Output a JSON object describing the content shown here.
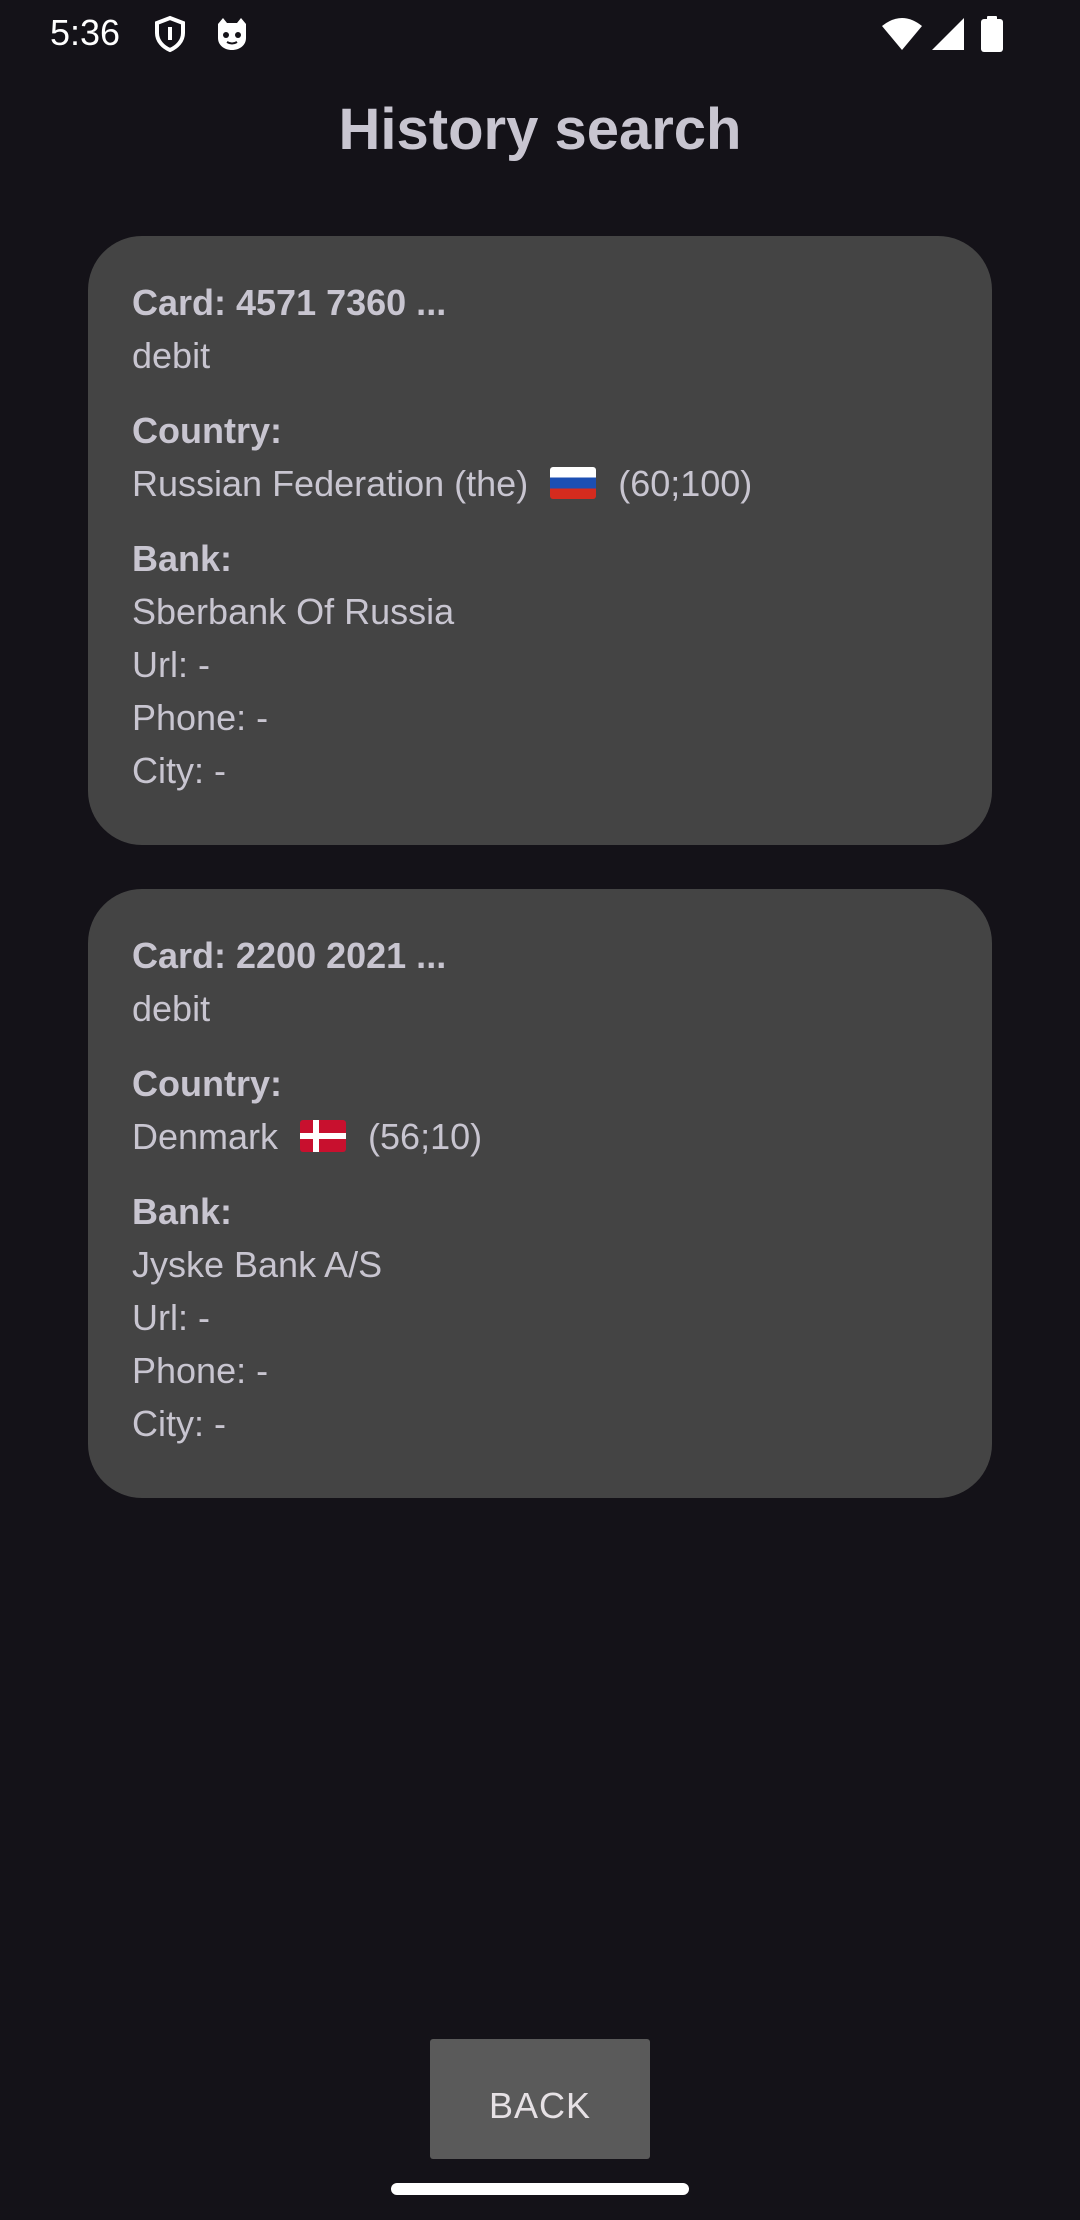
{
  "status_bar": {
    "time": "5:36",
    "left_icons": [
      "shield-icon",
      "cat-face-icon"
    ],
    "right_icons": [
      "wifi-icon",
      "signal-icon",
      "battery-icon"
    ]
  },
  "page": {
    "title": "History search"
  },
  "cards": [
    {
      "card_label": "Card: 4571 7360 ...",
      "card_type": "debit",
      "country_label": "Country:",
      "country_name": "Russian Federation (the)",
      "country_flag": "flag-russia-icon",
      "country_coords": "(60;100)",
      "bank_label": "Bank:",
      "bank_name": "Sberbank Of Russia",
      "url": "Url: -",
      "phone": "Phone: -",
      "city": "City: -"
    },
    {
      "card_label": "Card: 2200 2021 ...",
      "card_type": "debit",
      "country_label": "Country:",
      "country_name": "Denmark",
      "country_flag": "flag-denmark-icon",
      "country_coords": "(56;10)",
      "bank_label": "Bank:",
      "bank_name": "Jyske Bank A/S",
      "url": "Url: -",
      "phone": "Phone: -",
      "city": "City: -"
    }
  ],
  "actions": {
    "back_label": "BACK"
  },
  "colors": {
    "background": "#141218",
    "card": "#444444",
    "text": "#c8c5d0",
    "button": "#5a5a5a"
  }
}
